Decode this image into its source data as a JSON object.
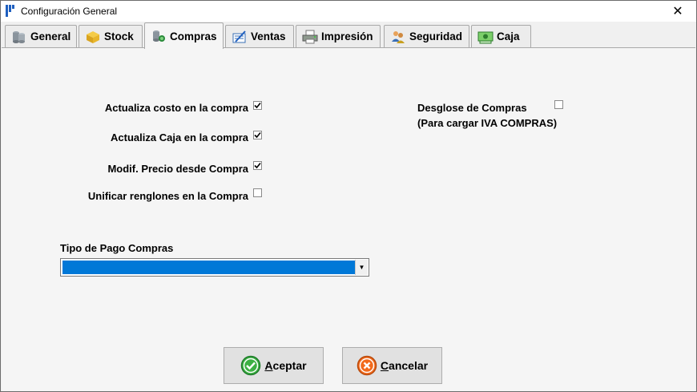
{
  "window": {
    "title": "Configuración General",
    "close_glyph": "✕"
  },
  "tabs": [
    {
      "label": "General",
      "icon": "cylinders-icon",
      "active": false
    },
    {
      "label": "Stock",
      "icon": "box-icon",
      "active": false
    },
    {
      "label": "Compras",
      "icon": "purchase-icon",
      "active": true
    },
    {
      "label": "Ventas",
      "icon": "sales-icon",
      "active": false
    },
    {
      "label": "Impresión",
      "icon": "printer-icon",
      "active": false
    },
    {
      "label": "Seguridad",
      "icon": "users-icon",
      "active": false
    },
    {
      "label": "Caja",
      "icon": "cash-icon",
      "active": false
    }
  ],
  "options": {
    "actualiza_costo": {
      "label": "Actualiza costo en la compra",
      "checked": true
    },
    "actualiza_caja": {
      "label": "Actualiza Caja en la compra",
      "checked": true
    },
    "modif_precio": {
      "label": "Modif. Precio desde Compra",
      "checked": true
    },
    "unificar_renglones": {
      "label": "Unificar renglones en la Compra",
      "checked": false
    },
    "desglose": {
      "label_line1": "Desglose de Compras",
      "label_line2": "(Para cargar IVA COMPRAS)",
      "checked": false
    }
  },
  "tipo_pago": {
    "label": "Tipo de Pago Compras",
    "value": ""
  },
  "buttons": {
    "aceptar_first": "A",
    "aceptar_rest": "ceptar",
    "cancelar_first": "C",
    "cancelar_rest": "ancelar"
  },
  "colors": {
    "selection": "#0078d7",
    "accept": "#3cb043",
    "cancel": "#f26b1d"
  }
}
